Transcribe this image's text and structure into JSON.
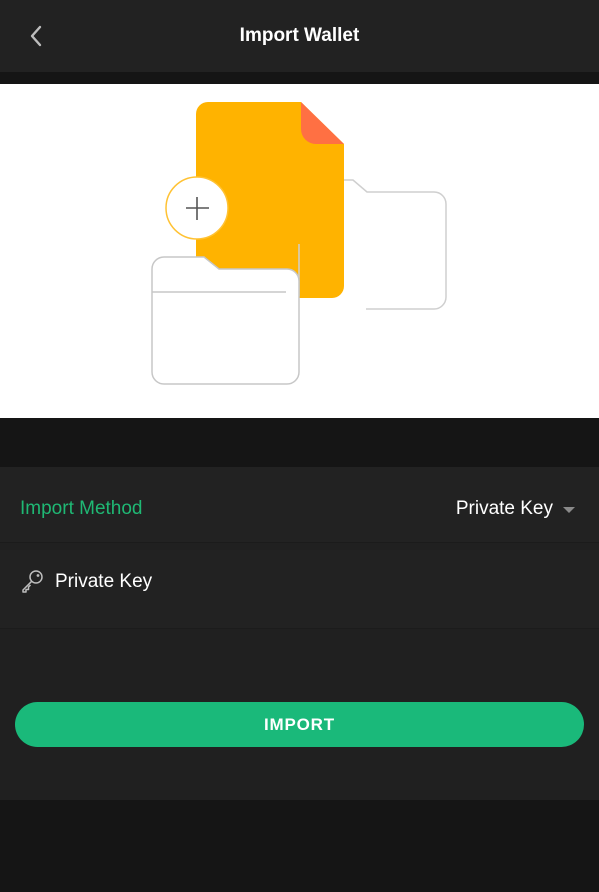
{
  "header": {
    "title": "Import Wallet",
    "back_icon": "chevron-left-icon"
  },
  "form": {
    "import_method_label": "Import Method",
    "import_method_value": "Private Key",
    "private_key_placeholder": "Private Key",
    "private_key_value": "",
    "key_icon": "key-icon",
    "import_button_label": "IMPORT"
  },
  "colors": {
    "accent": "#1ab97a",
    "accent_text": "#1fb874",
    "background": "#151515",
    "panel": "#222222",
    "document_yellow": "#ffb300",
    "document_corner": "#ff7043"
  }
}
